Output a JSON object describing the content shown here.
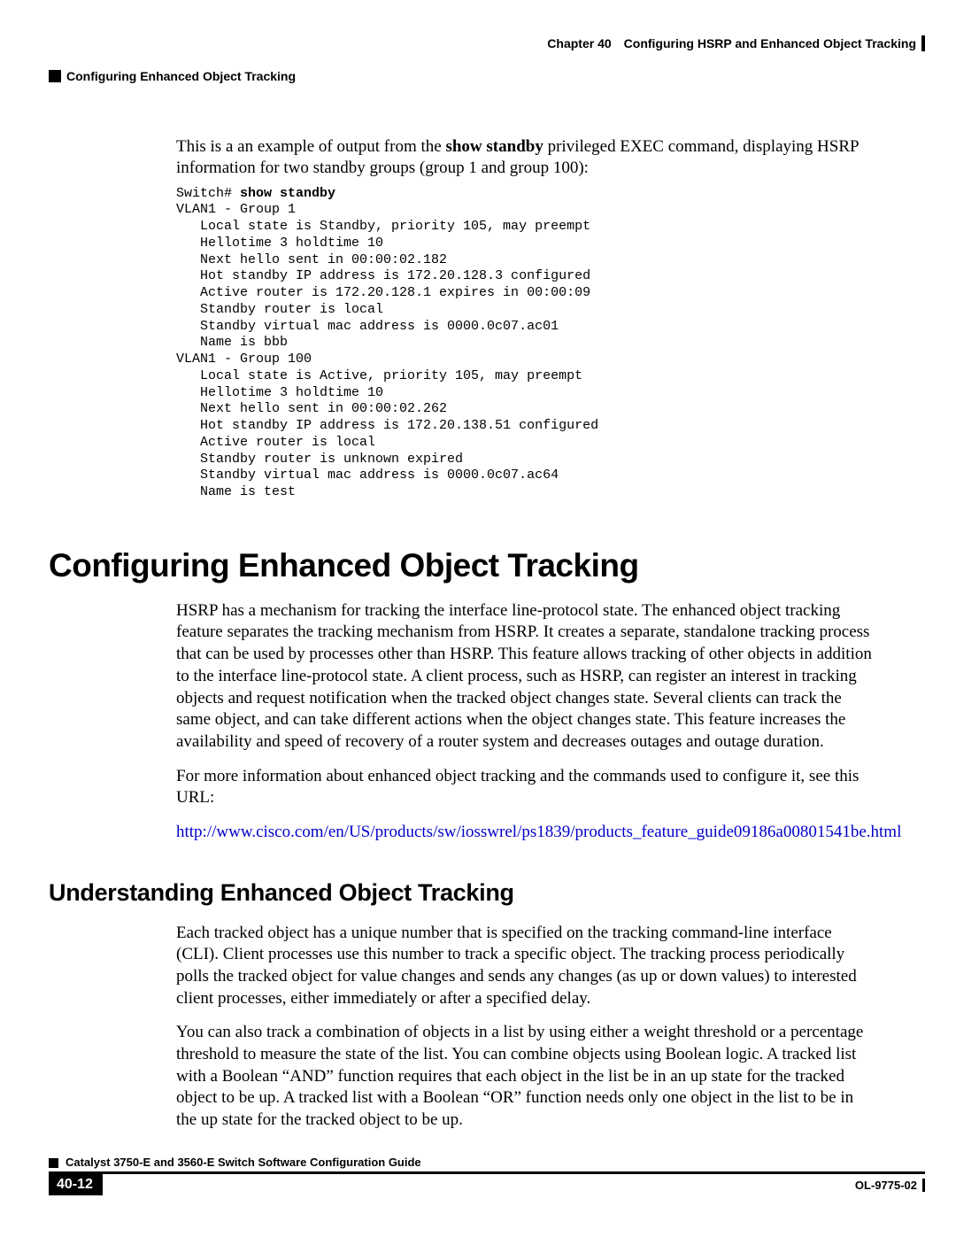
{
  "header": {
    "chapter_label": "Chapter 40",
    "chapter_title": "Configuring HSRP and Enhanced Object Tracking",
    "section_title": "Configuring Enhanced Object Tracking"
  },
  "intro_para_pre": "This is a an example of output from the ",
  "intro_cmd": "show standby",
  "intro_para_post": " privileged EXEC command, displaying HSRP information for two standby groups (group 1 and group 100):",
  "code_prompt": "Switch# ",
  "code_cmd": "show standby",
  "code_body": "VLAN1 - Group 1\n   Local state is Standby, priority 105, may preempt\n   Hellotime 3 holdtime 10\n   Next hello sent in 00:00:02.182\n   Hot standby IP address is 172.20.128.3 configured\n   Active router is 172.20.128.1 expires in 00:00:09\n   Standby router is local\n   Standby virtual mac address is 0000.0c07.ac01\n   Name is bbb\nVLAN1 - Group 100\n   Local state is Active, priority 105, may preempt\n   Hellotime 3 holdtime 10\n   Next hello sent in 00:00:02.262\n   Hot standby IP address is 172.20.138.51 configured\n   Active router is local\n   Standby router is unknown expired\n   Standby virtual mac address is 0000.0c07.ac64\n   Name is test",
  "h1": "Configuring Enhanced Object Tracking",
  "p1": "HSRP has a mechanism for tracking the interface line-protocol state. The enhanced object tracking feature separates the tracking mechanism from HSRP. It creates a separate, standalone tracking process that can be used by processes other than HSRP. This feature allows tracking of other objects in addition to the interface line-protocol state. A client process, such as HSRP, can register an interest in tracking objects and request notification when the tracked object changes state. Several clients can track the same object, and can take different actions when the object changes state. This feature increases the availability and speed of recovery of a router system and decreases outages and outage duration.",
  "p2": "For more information about enhanced object tracking and the commands used to configure it, see this URL:",
  "link": "http://www.cisco.com/en/US/products/sw/iosswrel/ps1839/products_feature_guide09186a00801541be.html",
  "h2": "Understanding Enhanced Object Tracking",
  "p3": "Each tracked object has a unique number that is specified on the tracking command-line interface (CLI). Client processes use this number to track a specific object. The tracking process periodically polls the tracked object for value changes and sends any changes (as up or down values) to interested client processes, either immediately or after a specified delay.",
  "p4": "You can also track a combination of objects in a list by using either a weight threshold or a percentage threshold to measure the state of the list. You can combine objects using Boolean logic. A tracked list with a Boolean “AND” function requires that each object in the list be in an up state for the tracked object to be up. A tracked list with a Boolean “OR” function needs only one object in the list to be in the up state for the tracked object to be up.",
  "footer": {
    "guide_title": "Catalyst 3750-E and 3560-E Switch Software Configuration Guide",
    "page_number": "40-12",
    "doc_id": "OL-9775-02"
  }
}
